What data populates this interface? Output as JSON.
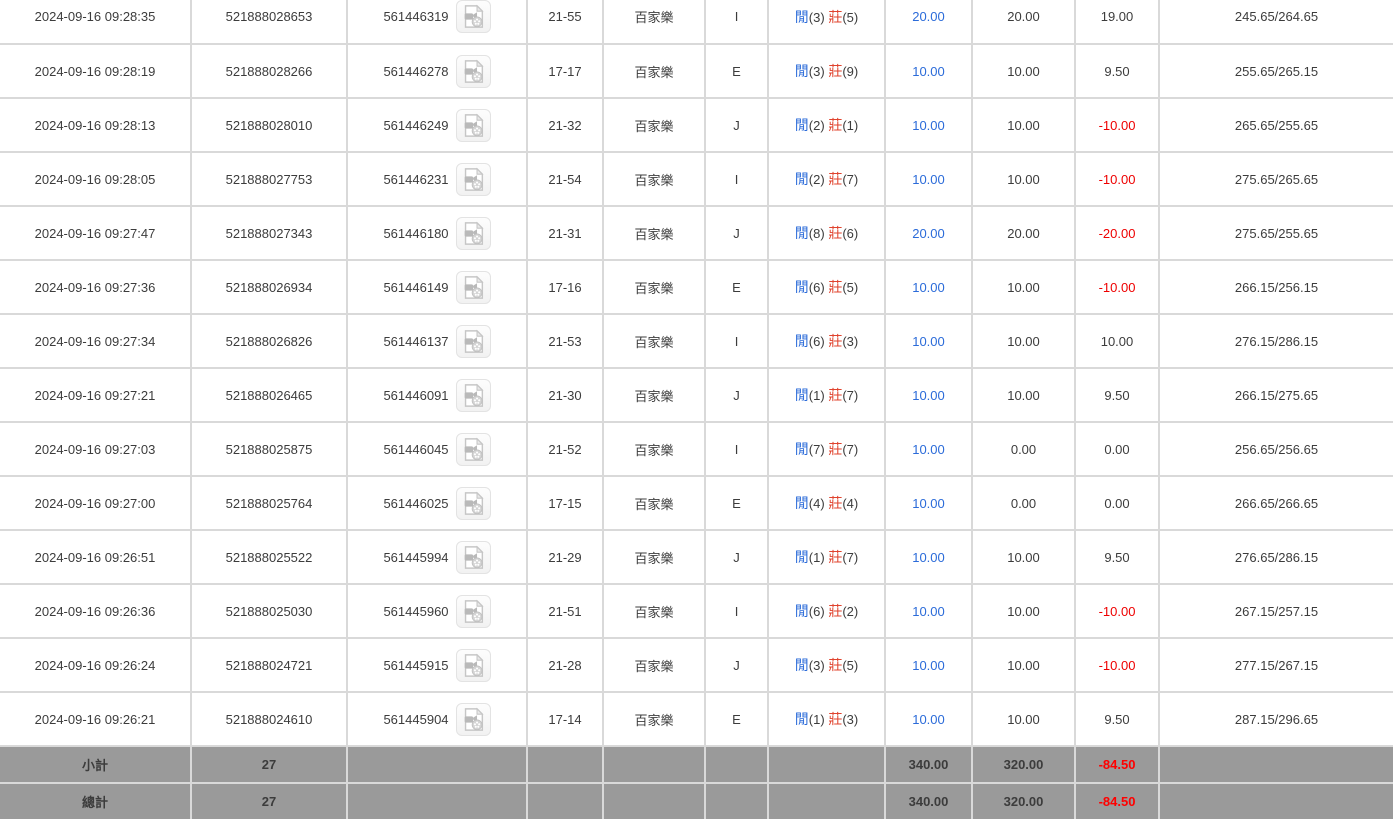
{
  "table": {
    "game_label": "百家樂",
    "rows": [
      {
        "time": "2024-09-16 09:28:35",
        "bet_id": "521888028653",
        "round_id": "561446319",
        "table_round": "21-55",
        "game": "百家樂",
        "bet_area": "I",
        "player_label": "閒",
        "player_score": "(3)",
        "banker_label": "莊",
        "banker_score": "(5)",
        "bet_amount": "20.00",
        "valid_bet": "20.00",
        "win_loss": "19.00",
        "balance": "245.65/264.65"
      },
      {
        "time": "2024-09-16 09:28:19",
        "bet_id": "521888028266",
        "round_id": "561446278",
        "table_round": "17-17",
        "game": "百家樂",
        "bet_area": "E",
        "player_label": "閒",
        "player_score": "(3)",
        "banker_label": "莊",
        "banker_score": "(9)",
        "bet_amount": "10.00",
        "valid_bet": "10.00",
        "win_loss": "9.50",
        "balance": "255.65/265.15"
      },
      {
        "time": "2024-09-16 09:28:13",
        "bet_id": "521888028010",
        "round_id": "561446249",
        "table_round": "21-32",
        "game": "百家樂",
        "bet_area": "J",
        "player_label": "閒",
        "player_score": "(2)",
        "banker_label": "莊",
        "banker_score": "(1)",
        "bet_amount": "10.00",
        "valid_bet": "10.00",
        "win_loss": "-10.00",
        "balance": "265.65/255.65"
      },
      {
        "time": "2024-09-16 09:28:05",
        "bet_id": "521888027753",
        "round_id": "561446231",
        "table_round": "21-54",
        "game": "百家樂",
        "bet_area": "I",
        "player_label": "閒",
        "player_score": "(2)",
        "banker_label": "莊",
        "banker_score": "(7)",
        "bet_amount": "10.00",
        "valid_bet": "10.00",
        "win_loss": "-10.00",
        "balance": "275.65/265.65"
      },
      {
        "time": "2024-09-16 09:27:47",
        "bet_id": "521888027343",
        "round_id": "561446180",
        "table_round": "21-31",
        "game": "百家樂",
        "bet_area": "J",
        "player_label": "閒",
        "player_score": "(8)",
        "banker_label": "莊",
        "banker_score": "(6)",
        "bet_amount": "20.00",
        "valid_bet": "20.00",
        "win_loss": "-20.00",
        "balance": "275.65/255.65"
      },
      {
        "time": "2024-09-16 09:27:36",
        "bet_id": "521888026934",
        "round_id": "561446149",
        "table_round": "17-16",
        "game": "百家樂",
        "bet_area": "E",
        "player_label": "閒",
        "player_score": "(6)",
        "banker_label": "莊",
        "banker_score": "(5)",
        "bet_amount": "10.00",
        "valid_bet": "10.00",
        "win_loss": "-10.00",
        "balance": "266.15/256.15"
      },
      {
        "time": "2024-09-16 09:27:34",
        "bet_id": "521888026826",
        "round_id": "561446137",
        "table_round": "21-53",
        "game": "百家樂",
        "bet_area": "I",
        "player_label": "閒",
        "player_score": "(6)",
        "banker_label": "莊",
        "banker_score": "(3)",
        "bet_amount": "10.00",
        "valid_bet": "10.00",
        "win_loss": "10.00",
        "balance": "276.15/286.15"
      },
      {
        "time": "2024-09-16 09:27:21",
        "bet_id": "521888026465",
        "round_id": "561446091",
        "table_round": "21-30",
        "game": "百家樂",
        "bet_area": "J",
        "player_label": "閒",
        "player_score": "(1)",
        "banker_label": "莊",
        "banker_score": "(7)",
        "bet_amount": "10.00",
        "valid_bet": "10.00",
        "win_loss": "9.50",
        "balance": "266.15/275.65"
      },
      {
        "time": "2024-09-16 09:27:03",
        "bet_id": "521888025875",
        "round_id": "561446045",
        "table_round": "21-52",
        "game": "百家樂",
        "bet_area": "I",
        "player_label": "閒",
        "player_score": "(7)",
        "banker_label": "莊",
        "banker_score": "(7)",
        "bet_amount": "10.00",
        "valid_bet": "0.00",
        "win_loss": "0.00",
        "balance": "256.65/256.65"
      },
      {
        "time": "2024-09-16 09:27:00",
        "bet_id": "521888025764",
        "round_id": "561446025",
        "table_round": "17-15",
        "game": "百家樂",
        "bet_area": "E",
        "player_label": "閒",
        "player_score": "(4)",
        "banker_label": "莊",
        "banker_score": "(4)",
        "bet_amount": "10.00",
        "valid_bet": "0.00",
        "win_loss": "0.00",
        "balance": "266.65/266.65"
      },
      {
        "time": "2024-09-16 09:26:51",
        "bet_id": "521888025522",
        "round_id": "561445994",
        "table_round": "21-29",
        "game": "百家樂",
        "bet_area": "J",
        "player_label": "閒",
        "player_score": "(1)",
        "banker_label": "莊",
        "banker_score": "(7)",
        "bet_amount": "10.00",
        "valid_bet": "10.00",
        "win_loss": "9.50",
        "balance": "276.65/286.15"
      },
      {
        "time": "2024-09-16 09:26:36",
        "bet_id": "521888025030",
        "round_id": "561445960",
        "table_round": "21-51",
        "game": "百家樂",
        "bet_area": "I",
        "player_label": "閒",
        "player_score": "(6)",
        "banker_label": "莊",
        "banker_score": "(2)",
        "bet_amount": "10.00",
        "valid_bet": "10.00",
        "win_loss": "-10.00",
        "balance": "267.15/257.15"
      },
      {
        "time": "2024-09-16 09:26:24",
        "bet_id": "521888024721",
        "round_id": "561445915",
        "table_round": "21-28",
        "game": "百家樂",
        "bet_area": "J",
        "player_label": "閒",
        "player_score": "(3)",
        "banker_label": "莊",
        "banker_score": "(5)",
        "bet_amount": "10.00",
        "valid_bet": "10.00",
        "win_loss": "-10.00",
        "balance": "277.15/267.15"
      },
      {
        "time": "2024-09-16 09:26:21",
        "bet_id": "521888024610",
        "round_id": "561445904",
        "table_round": "17-14",
        "game": "百家樂",
        "bet_area": "E",
        "player_label": "閒",
        "player_score": "(1)",
        "banker_label": "莊",
        "banker_score": "(3)",
        "bet_amount": "10.00",
        "valid_bet": "10.00",
        "win_loss": "9.50",
        "balance": "287.15/296.65"
      }
    ],
    "footer": {
      "subtotal": {
        "label": "小計",
        "count": "27",
        "bet_total": "340.00",
        "valid_total": "320.00",
        "win_loss_total": "-84.50"
      },
      "grand_total": {
        "label": "總計",
        "count": "27",
        "bet_total": "340.00",
        "valid_total": "320.00",
        "win_loss_total": "-84.50"
      }
    }
  },
  "icons": {
    "replay": "video-file-icon"
  },
  "colors": {
    "link_blue": "#2b6bd9",
    "banker_red": "#e0432e",
    "loss_red": "#ee0000",
    "footer_loss_red": "#ff0000",
    "footer_bg": "#9a9a9a",
    "border": "#d9d9d9",
    "text": "#3c3c3c"
  }
}
